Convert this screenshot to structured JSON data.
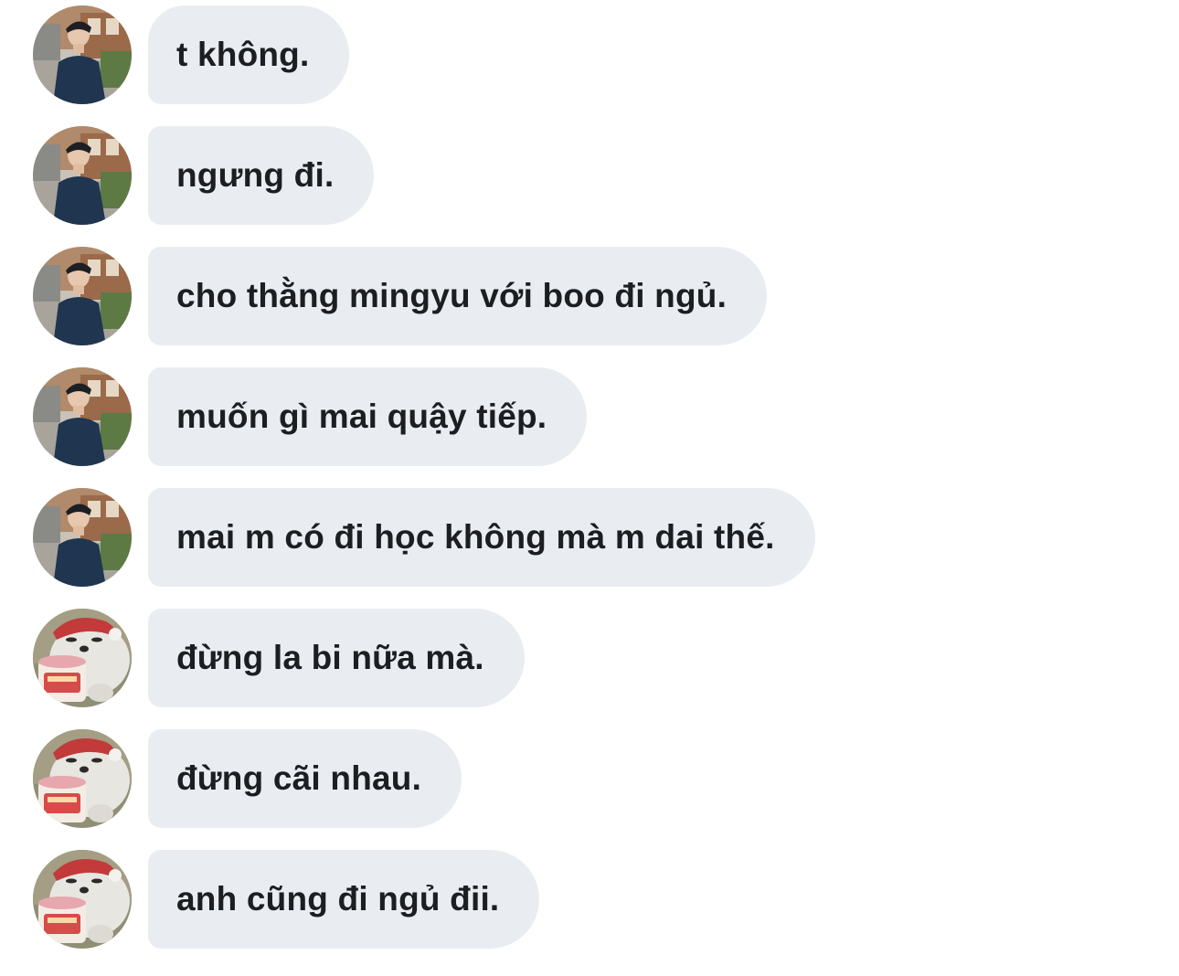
{
  "conversation": {
    "messages": [
      {
        "sender_avatar": "person-photo",
        "text": "t không."
      },
      {
        "sender_avatar": "person-photo",
        "text": "ngưng đi."
      },
      {
        "sender_avatar": "person-photo",
        "text": "cho thằng mingyu với boo đi ngủ."
      },
      {
        "sender_avatar": "person-photo",
        "text": "muốn gì mai quậy tiếp."
      },
      {
        "sender_avatar": "person-photo",
        "text": "mai m có đi học không mà m dai thế."
      },
      {
        "sender_avatar": "bear-ice-cream-cartoon",
        "text": "đừng la bi nữa mà."
      },
      {
        "sender_avatar": "bear-ice-cream-cartoon",
        "text": "đừng cãi nhau."
      },
      {
        "sender_avatar": "bear-ice-cream-cartoon",
        "text": "anh cũng đi ngủ đii."
      }
    ]
  },
  "colors": {
    "bubble_bg": "#e9edf1",
    "text": "#1c1e21",
    "background": "#ffffff"
  }
}
